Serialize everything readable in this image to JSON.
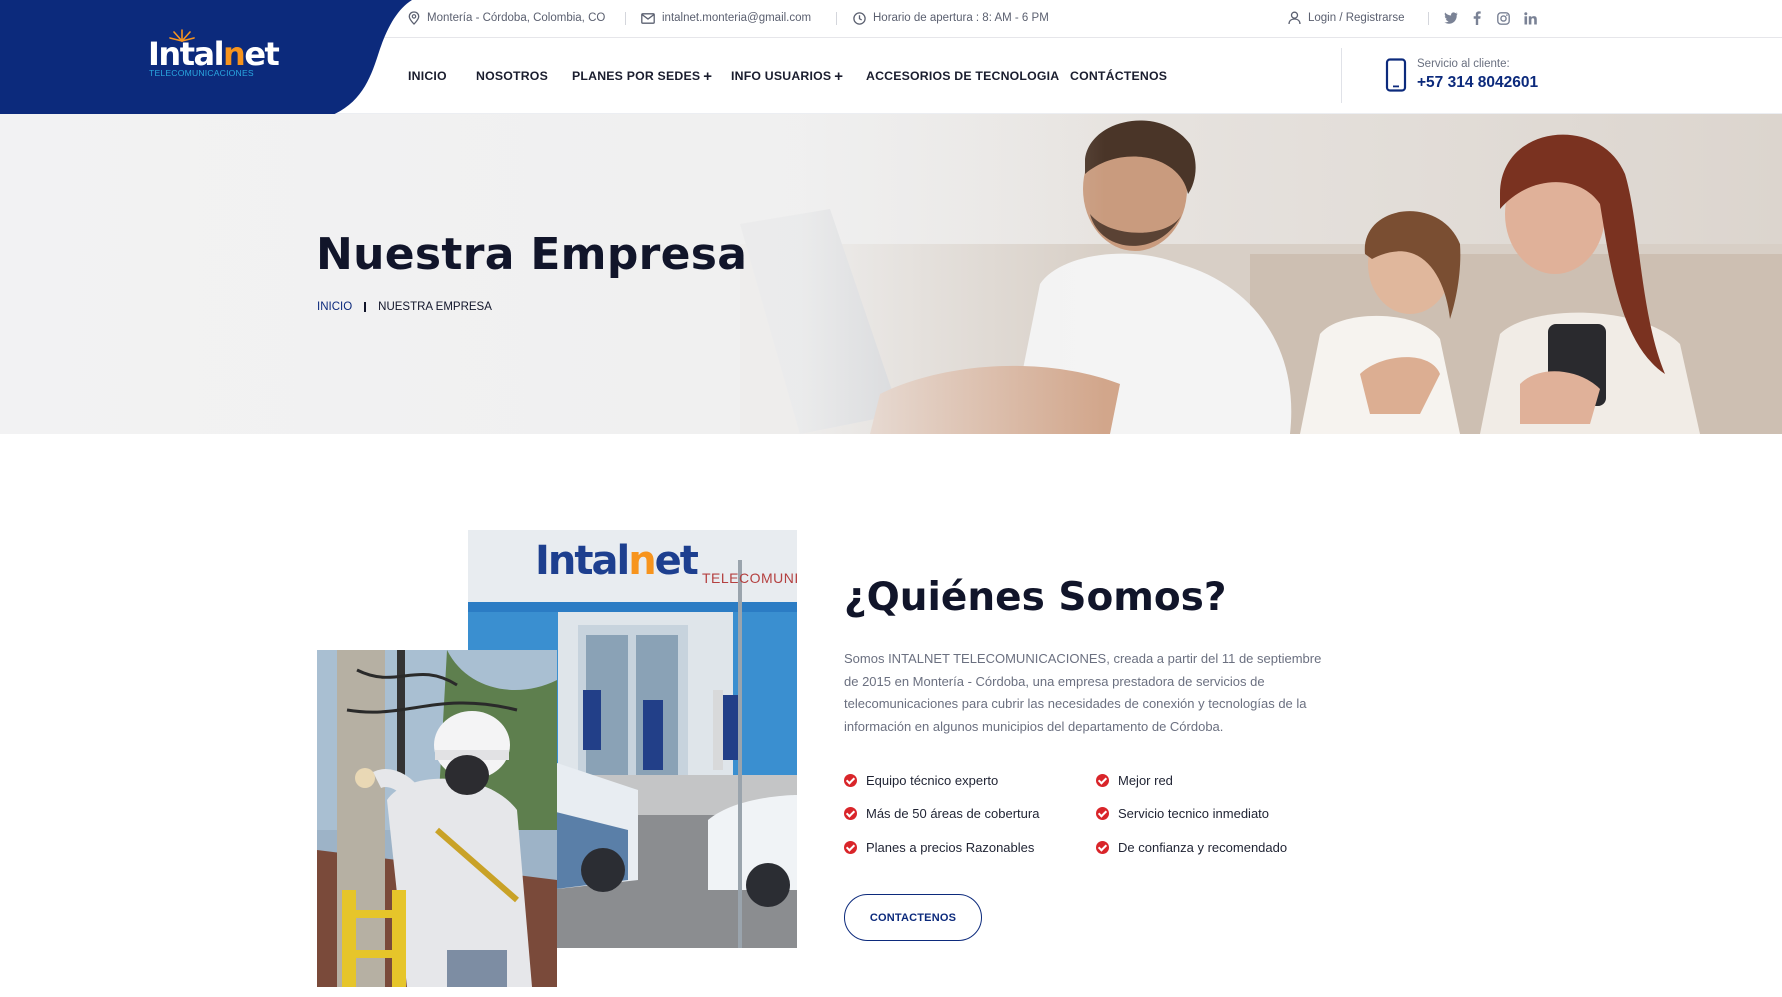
{
  "brand": {
    "logo_word_a": "Intal",
    "logo_word_b": "n",
    "logo_word_c": "et",
    "logo_sub": "TELECOMUNICACIONES",
    "primary_color": "#0c2a7c",
    "accent_color": "#f7941d",
    "check_color": "#d9252a"
  },
  "topbar": {
    "location": "Montería - Córdoba, Colombia, CO",
    "email": "intalnet.monteria@gmail.com",
    "hours": "Horario de apertura : 8: AM - 6 PM",
    "login": "Login / Registrarse",
    "social": [
      "twitter-icon",
      "facebook-icon",
      "instagram-icon",
      "linkedin-icon"
    ]
  },
  "nav": {
    "items": [
      "INICIO",
      "NOSOTROS",
      "PLANES POR SEDES",
      "INFO USUARIOS",
      "ACCESORIOS DE TECNOLOGIA",
      "CONTÁCTENOS"
    ],
    "plus": "+",
    "service_label": "Servicio al cliente:",
    "service_phone": "+57 314 8042601"
  },
  "hero": {
    "title": "Nuestra Empresa",
    "breadcrumb_home": "INICIO",
    "breadcrumb_current": "NUESTRA EMPRESA"
  },
  "about": {
    "store_sign_a": "Intal",
    "store_sign_b": "n",
    "store_sign_c": "et",
    "store_sign_sub": "TELECOMUNIC",
    "title": "¿Quiénes Somos?",
    "text": "Somos INTALNET TELECOMUNICACIONES, creada a partir del 11 de septiembre de 2015 en Montería - Córdoba, una empresa prestadora de servicios de telecomunicaciones para cubrir las necesidades de conexión y tecnologías de la información en algunos municipios del departamento de Córdoba.",
    "features": [
      "Equipo técnico experto",
      "Mejor red",
      "Más de 50 áreas de cobertura",
      "Servicio tecnico inmediato",
      "Planes a precios Razonables",
      "De confianza y recomendado"
    ],
    "cta": "CONTACTENOS"
  }
}
